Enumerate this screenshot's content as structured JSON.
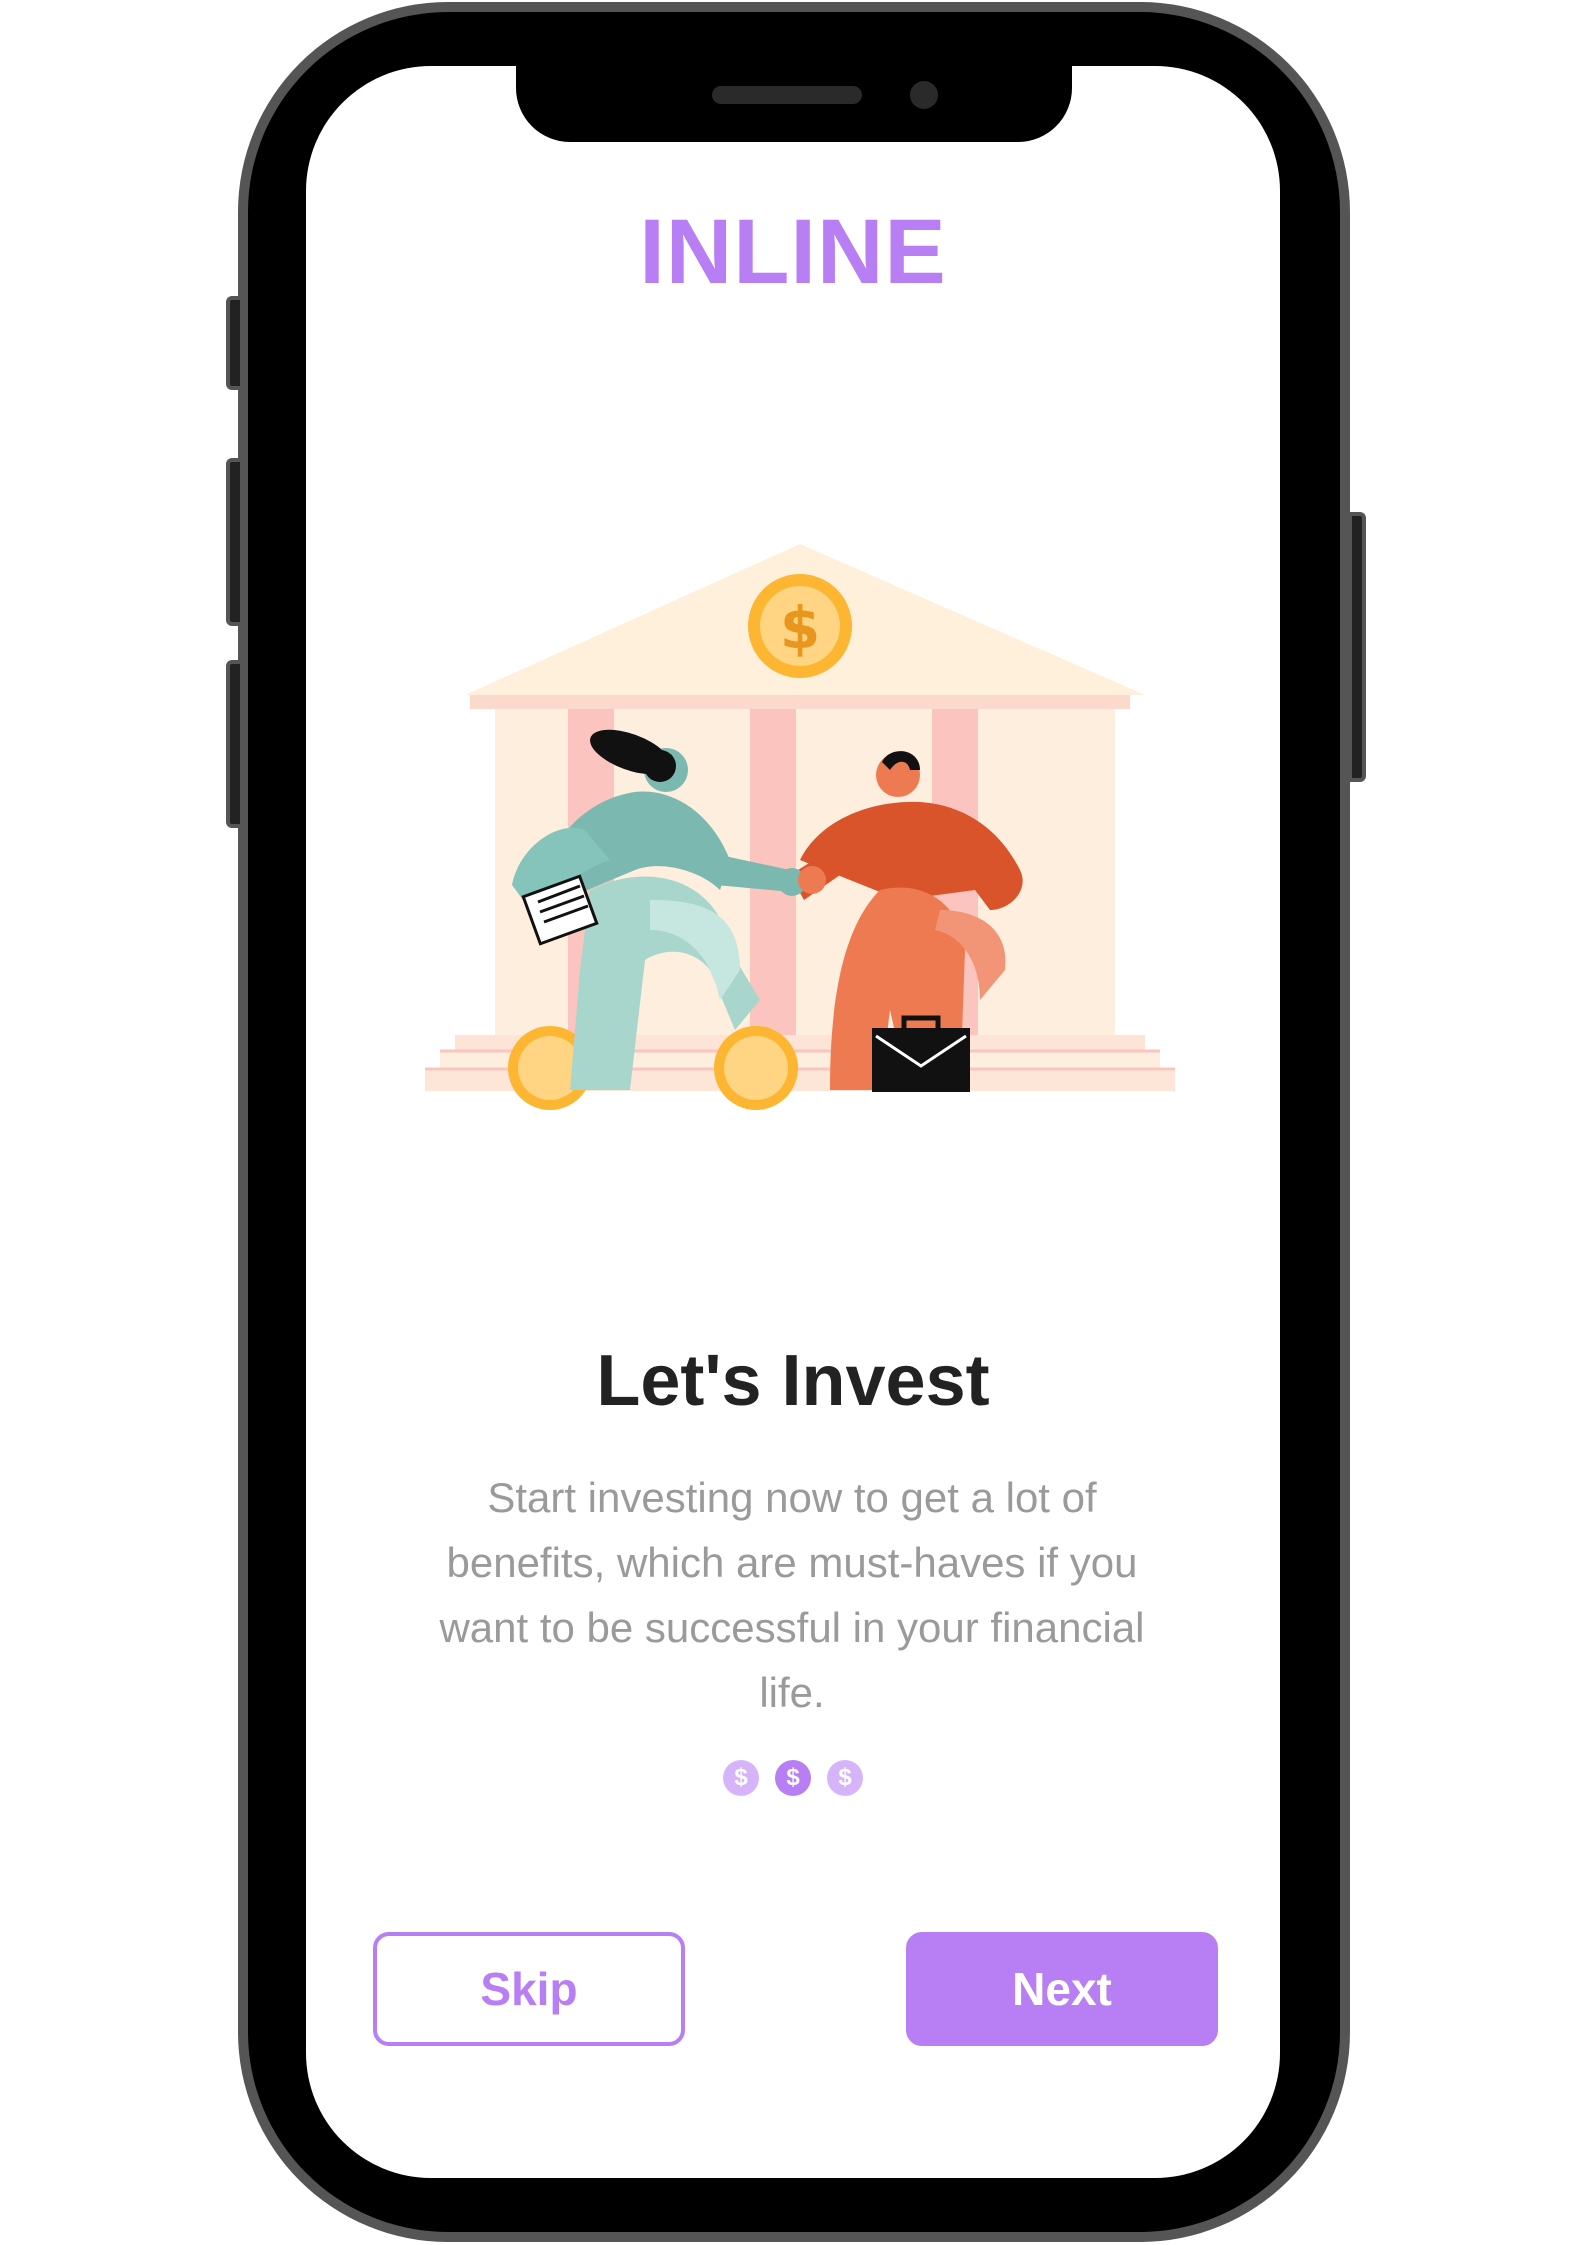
{
  "app": {
    "brand": "INLINE",
    "brand_color": "#b77ff3"
  },
  "onboarding": {
    "title": "Let's Invest",
    "description": "Start investing now to get a lot of benefits, which are must-haves if you want to be successful in your financial life.",
    "page_indicator": {
      "total": 3,
      "active_index": 1,
      "symbol": "$"
    }
  },
  "illustration": {
    "coin_symbol": "$"
  },
  "actions": {
    "skip_label": "Skip",
    "next_label": "Next"
  },
  "colors": {
    "accent": "#b77ff3",
    "dot_inactive": "#d6b4fa",
    "title": "#222222",
    "body": "#9a9a9a"
  }
}
